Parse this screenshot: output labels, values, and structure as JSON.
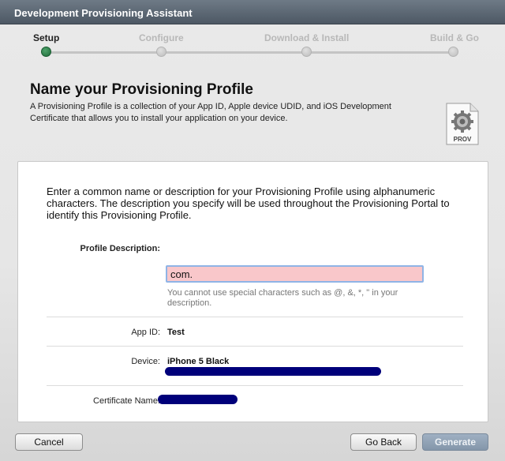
{
  "window": {
    "title": "Development Provisioning Assistant"
  },
  "steps": [
    {
      "label": "Setup",
      "active": true
    },
    {
      "label": "Configure",
      "active": false
    },
    {
      "label": "Download & Install",
      "active": false
    },
    {
      "label": "Build & Go",
      "active": false
    }
  ],
  "header": {
    "title": "Name your Provisioning Profile",
    "description": "A Provisioning Profile is a collection of your App ID, Apple device UDID, and iOS Development Certificate that allows you to install your application on your device.",
    "icon": {
      "name": "prov-document-icon",
      "label": "PROV"
    }
  },
  "form": {
    "intro": "Enter a common name or description for your Provisioning Profile using alphanumeric characters. The description you specify will be used throughout the Provisioning Portal to identify this Provisioning Profile.",
    "profile_description": {
      "label": "Profile Description:",
      "value": "com.",
      "hint": "You cannot use special characters such as @, &, *, \" in your description."
    },
    "app_id": {
      "label": "App ID:",
      "value": "Test"
    },
    "device": {
      "label": "Device:",
      "value": "iPhone 5 Black"
    },
    "certificate": {
      "label": "Certificate Name:"
    }
  },
  "buttons": {
    "cancel": "Cancel",
    "go_back": "Go Back",
    "generate": "Generate"
  },
  "colors": {
    "invalid_input_bg": "#f9c7ca",
    "redaction": "#00007a",
    "active_step": "#1e6b3a"
  }
}
